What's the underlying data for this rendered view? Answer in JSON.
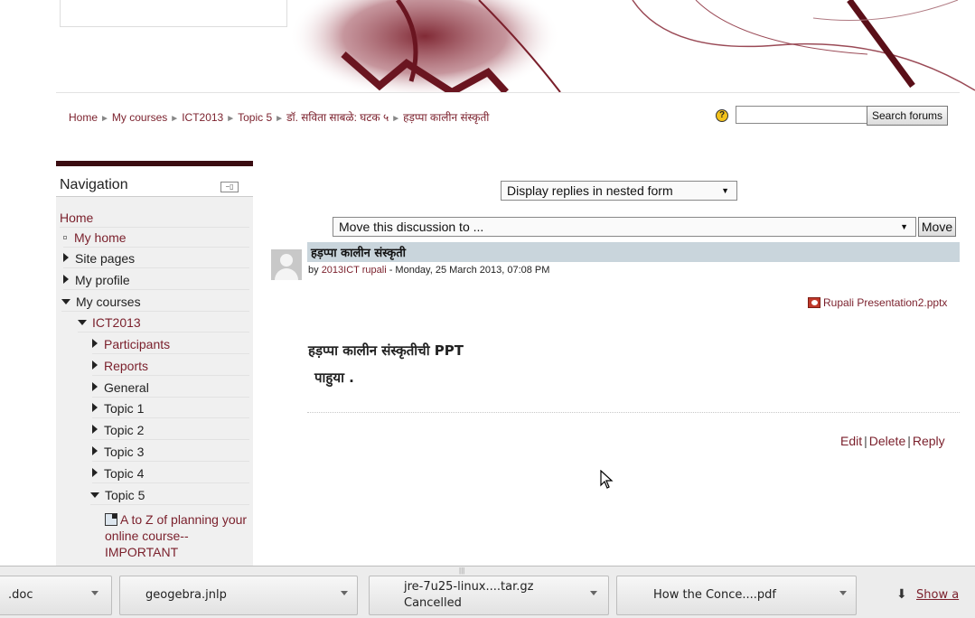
{
  "breadcrumb": [
    "Home",
    "My courses",
    "ICT2013",
    "Topic 5",
    "डॉ. सविता साबळे: घटक ५",
    "हड़प्पा कालीन संस्कृती"
  ],
  "search": {
    "button_label": "Search forums",
    "help_glyph": "?"
  },
  "navigation": {
    "title": "Navigation",
    "home": "Home",
    "items": [
      {
        "label": "My home",
        "kind": "bullet"
      },
      {
        "label": "Site pages",
        "kind": "collapsed"
      },
      {
        "label": "My profile",
        "kind": "collapsed"
      },
      {
        "label": "My courses",
        "kind": "expanded"
      },
      {
        "label": "ICT2013",
        "kind": "expanded"
      },
      {
        "label": "Participants",
        "kind": "collapsed"
      },
      {
        "label": "Reports",
        "kind": "collapsed"
      },
      {
        "label": "General",
        "kind": "collapsed"
      },
      {
        "label": "Topic 1",
        "kind": "collapsed"
      },
      {
        "label": "Topic 2",
        "kind": "collapsed"
      },
      {
        "label": "Topic 3",
        "kind": "collapsed"
      },
      {
        "label": "Topic 4",
        "kind": "collapsed"
      },
      {
        "label": "Topic 5",
        "kind": "expanded"
      }
    ],
    "resource_label": "A to Z of planning your online course--IMPORTANT"
  },
  "discussion": {
    "display_mode": "Display replies in nested form",
    "move_placeholder": "Move this discussion to ...",
    "move_button": "Move"
  },
  "post": {
    "subject": "हड़प्पा कालीन संस्कृती",
    "by": "by",
    "author": "2013ICT rupali",
    "date": " - Monday, 25 March 2013, 07:08 PM",
    "attachment": "Rupali Presentation2.pptx",
    "body_line1": "हड़प्पा  कालीन  संस्कृतीची  PPT",
    "body_line2": "पाहुया .",
    "actions": [
      "Edit",
      "Delete",
      "Reply"
    ]
  },
  "downloads": {
    "items": [
      {
        "name": ".doc",
        "status": ""
      },
      {
        "name": "geogebra.jnlp",
        "status": ""
      },
      {
        "name": "jre-7u25-linux....tar.gz",
        "status": "Cancelled"
      },
      {
        "name": "How the Conce....pdf",
        "status": ""
      }
    ],
    "show_all": "Show a"
  },
  "colors": {
    "link": "#7a1f2b",
    "subject_bar": "#c9d5dc",
    "nav_bg": "#f0f0f0",
    "accent_dark": "#3b0d12"
  }
}
